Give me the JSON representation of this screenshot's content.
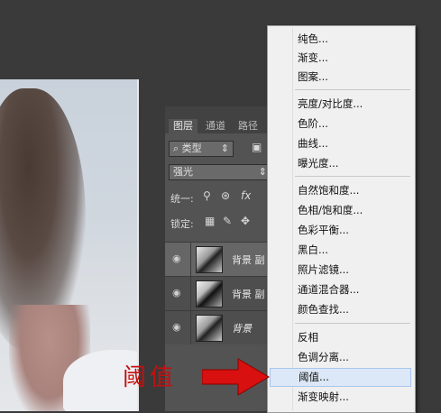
{
  "layers_panel": {
    "tabs": [
      "图层",
      "通道",
      "路径"
    ],
    "filter_kind": "类型",
    "blend_mode": "强光",
    "unify_label": "统一:",
    "lock_label": "锁定:",
    "layers": [
      {
        "name": "背景 副",
        "selected": true
      },
      {
        "name": "背景 副",
        "selected": false
      },
      {
        "name": "背景",
        "selected": false
      }
    ]
  },
  "menu": {
    "groups": [
      [
        "纯色...",
        "渐变...",
        "图案..."
      ],
      [
        "亮度/对比度...",
        "色阶...",
        "曲线...",
        "曝光度..."
      ],
      [
        "自然饱和度...",
        "色相/饱和度...",
        "色彩平衡...",
        "黑白...",
        "照片滤镜...",
        "通道混合器...",
        "颜色查找..."
      ],
      [
        "反相",
        "色调分离...",
        "阈值...",
        "渐变映射..."
      ]
    ],
    "highlighted": "阈值..."
  },
  "annotation": {
    "text": "阈值",
    "color": "#c41010"
  }
}
